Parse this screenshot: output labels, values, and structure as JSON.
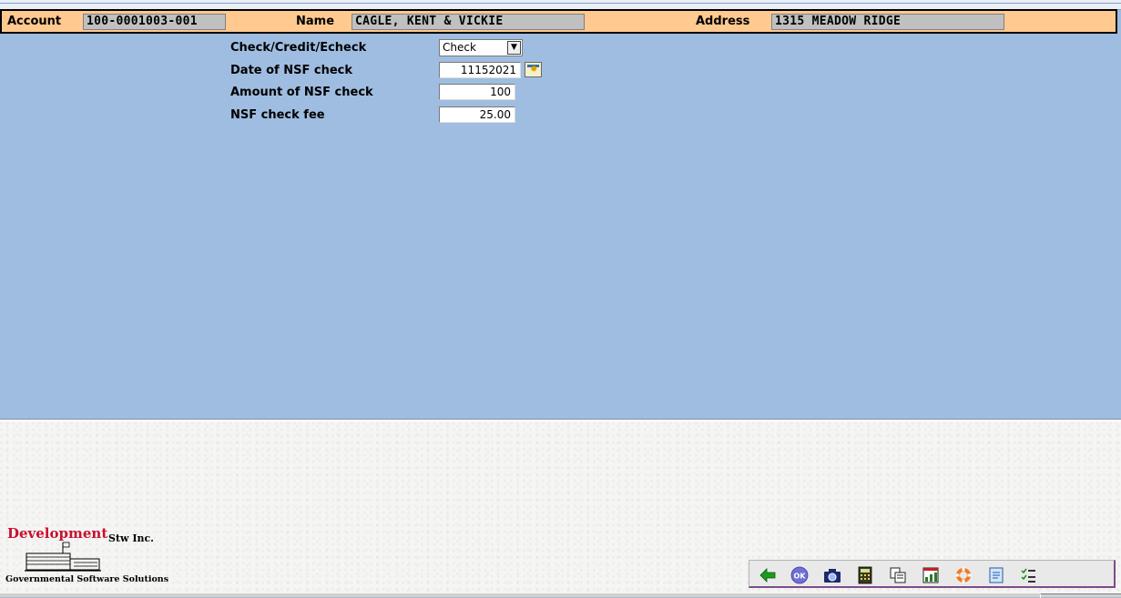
{
  "header": {
    "account_label": "Account",
    "account_value": "100-0001003-001",
    "name_label": "Name",
    "name_value": "CAGLE, KENT & VICKIE",
    "address_label": "Address",
    "address_value": "1315 MEADOW RIDGE"
  },
  "form": {
    "payment_type_label": "Check/Credit/Echeck",
    "payment_type_selected": "Check",
    "nsf_date_label": "Date of NSF check",
    "nsf_date_value": "11152021",
    "nsf_amount_label": "Amount of NSF check",
    "nsf_amount_value": "100",
    "nsf_fee_label": "NSF check fee",
    "nsf_fee_value": "25.00"
  },
  "logo": {
    "development": "Development",
    "company": "Stw Inc.",
    "tagline": "Governmental Software Solutions"
  },
  "toolbar": {
    "icons": [
      "back-arrow-icon",
      "ok-icon",
      "camera-icon",
      "calculator-icon",
      "copy-icon",
      "report-icon",
      "help-lifebuoy-icon",
      "notes-icon",
      "checklist-icon"
    ]
  },
  "colors": {
    "form_background": "#9fbde0",
    "header_background": "#ffc98f",
    "logo_red": "#c8102e"
  }
}
